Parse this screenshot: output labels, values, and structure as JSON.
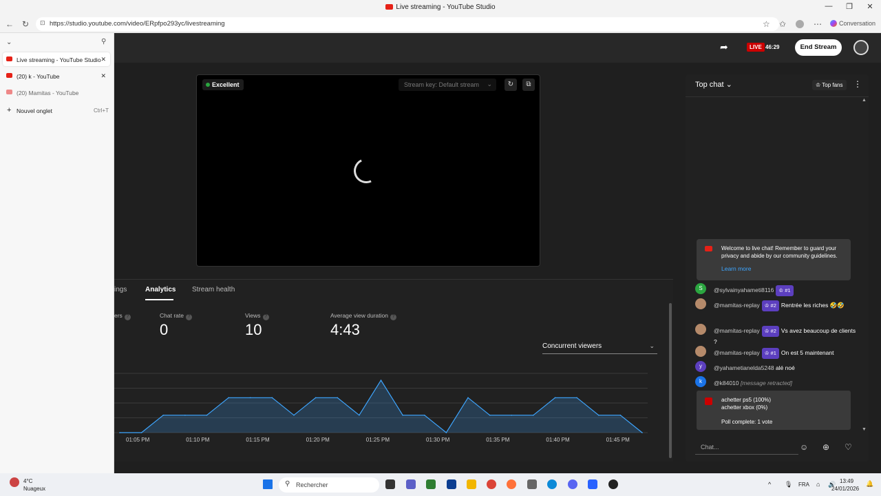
{
  "window": {
    "title": "Live streaming - YouTube Studio",
    "minimize": "—",
    "maximize": "❐",
    "close": "✕"
  },
  "browser": {
    "url": "https://studio.youtube.com/video/ERpfpo293yc/livestreaming",
    "profile_button": "Conversation"
  },
  "tabs": [
    {
      "title": "Live streaming - YouTube Studio",
      "close": "✕"
    },
    {
      "title": "(20) k - YouTube",
      "close": "✕"
    },
    {
      "title": "(20) Mamitas - YouTube"
    }
  ],
  "new_tab": {
    "label": "Nouvel onglet",
    "shortcut": "Ctrl+T",
    "plus": "+"
  },
  "header": {
    "live_badge": "LIVE",
    "elapsed": "46:29",
    "end_stream": "End Stream"
  },
  "preview": {
    "quality": "Excellent",
    "stream_key": "Stream key: Default stream"
  },
  "analytics": {
    "tabs": [
      "ings",
      "Analytics",
      "Stream health"
    ],
    "stats": [
      {
        "label": "ers",
        "value": ""
      },
      {
        "label": "Chat rate",
        "value": "0"
      },
      {
        "label": "Views",
        "value": "10"
      },
      {
        "label": "Average view duration",
        "value": "4:43"
      }
    ],
    "dropdown": "Concurrent viewers",
    "x_labels": [
      "01:05 PM",
      "01:10 PM",
      "01:15 PM",
      "01:20 PM",
      "01:25 PM",
      "01:30 PM",
      "01:35 PM",
      "01:40 PM",
      "01:45 PM"
    ]
  },
  "chart_data": {
    "type": "area",
    "title": "",
    "xlabel": "",
    "ylabel": "",
    "x": [
      "01:05 PM",
      "01:07 PM",
      "01:08 PM",
      "01:10 PM",
      "01:12 PM",
      "01:14 PM",
      "01:15 PM",
      "01:17 PM",
      "01:18 PM",
      "01:20 PM",
      "01:22 PM",
      "01:23 PM",
      "01:25 PM",
      "01:27 PM",
      "01:28 PM",
      "01:30 PM",
      "01:32 PM",
      "01:34 PM",
      "01:35 PM",
      "01:38 PM",
      "01:40 PM",
      "01:42 PM",
      "01:44 PM",
      "01:45 PM",
      "01:47 PM"
    ],
    "series": [
      {
        "values": [
          0,
          0,
          1,
          1,
          1,
          2,
          2,
          2,
          1,
          2,
          2,
          1,
          3,
          1,
          1,
          0,
          2,
          1,
          1,
          1,
          2,
          2,
          1,
          1,
          0
        ]
      }
    ],
    "ylim": [
      0,
      3
    ],
    "grid": true,
    "color": "#3ea6ff"
  },
  "chat": {
    "mode": "Top chat",
    "top_fans": "Top fans",
    "welcome_text": "Welcome to live chat! Remember to guard your privacy and abide by our community guidelines.",
    "learn_more": "Learn more",
    "messages": [
      {
        "author": "@sylvainyahameti8116",
        "badge": "#1",
        "text": "",
        "color": "#2ba640",
        "initial": "S"
      },
      {
        "author": "@mamitas-replay",
        "badge": "#2",
        "text": "Rentrée les riches 🤣🤣",
        "color": "#b58a6a",
        "initial": ""
      },
      {
        "author": "@mamitas-replay",
        "badge": "#2",
        "text": "Vs avez beaucoup de clients ?",
        "color": "#b58a6a",
        "initial": ""
      },
      {
        "author": "@mamitas-replay",
        "badge": "#1",
        "text": "On est 5 maintenant",
        "color": "#b58a6a",
        "initial": ""
      },
      {
        "author": "@yahametianelda5248",
        "badge": "",
        "text": "alé noé",
        "color": "#5c3fbf",
        "initial": "y"
      },
      {
        "author": "@k84010",
        "badge": "",
        "text": "[message retracted]",
        "color": "#1a73e8",
        "initial": "k"
      }
    ],
    "poll": {
      "option1": "achetter ps5 (100%)",
      "option2": "achetter xbox (0%)",
      "status": "Poll complete: 1 vote"
    },
    "input_placeholder": "Chat..."
  },
  "taskbar": {
    "weather_temp": "4°C",
    "weather_desc": "Nuageux",
    "search": "Rechercher",
    "lang": "FRA",
    "time": "13:49",
    "date": "24/01/2026"
  }
}
